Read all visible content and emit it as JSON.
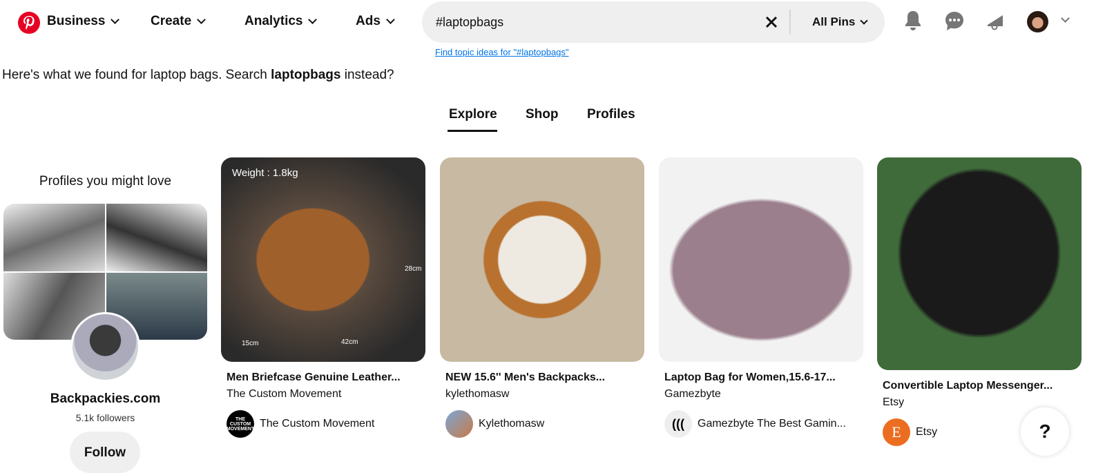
{
  "nav": {
    "logo": "pinterest-logo",
    "items": [
      {
        "label": "Business"
      },
      {
        "label": "Create"
      },
      {
        "label": "Analytics"
      },
      {
        "label": "Ads"
      }
    ]
  },
  "search": {
    "value": "#laptopbags",
    "filter": "All Pins",
    "topic_link": "Find topic ideas for \"#laptopbags\""
  },
  "header_icons": [
    "bell-icon",
    "chat-icon",
    "megaphone-icon",
    "avatar"
  ],
  "notice": {
    "prefix": "Here's what we found for laptop bags. Search ",
    "term": "laptopbags",
    "suffix": " instead?"
  },
  "tabs": [
    {
      "label": "Explore",
      "active": true
    },
    {
      "label": "Shop"
    },
    {
      "label": "Profiles"
    }
  ],
  "profile_card": {
    "heading": "Profiles you might love",
    "name": "Backpackies.com",
    "followers": "5.1k followers",
    "follow": "Follow"
  },
  "pins": [
    {
      "title": "Men Briefcase Genuine Leather...",
      "subtitle": "The Custom Movement",
      "creator": "The Custom Movement",
      "avatar_text": "THE CUSTOM MOVEMENT",
      "overlay": "Weight : 1.8kg",
      "dims": [
        "28cm",
        "15cm",
        "42cm"
      ]
    },
    {
      "title": "NEW 15.6'' Men's Backpacks...",
      "subtitle": "kylethomasw",
      "creator": "Kylethomasw"
    },
    {
      "title": "Laptop Bag for Women,15.6-17...",
      "subtitle": "Gamezbyte",
      "creator": "Gamezbyte The Best Gamin..."
    },
    {
      "title": "Convertible Laptop Messenger...",
      "subtitle": "Etsy",
      "creator": "Etsy",
      "avatar_text": "E"
    }
  ],
  "help": "?",
  "colors": {
    "brand": "#e60023",
    "link": "#0074e8",
    "search_bg": "#efefef",
    "etsy": "#eb6d20"
  }
}
